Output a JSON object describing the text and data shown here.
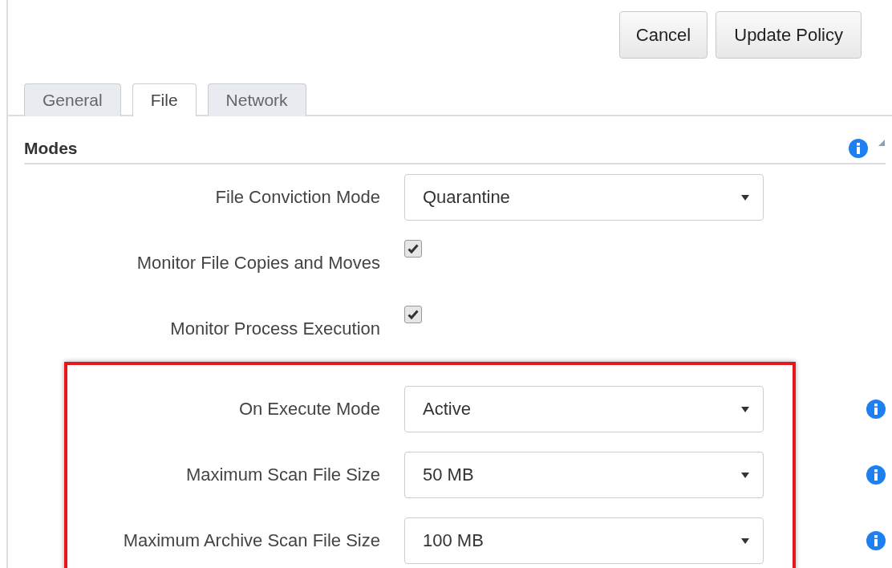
{
  "buttons": [
    {
      "label": "Cancel",
      "kind": "secondary"
    },
    {
      "label": "Update Policy",
      "kind": "primary"
    }
  ],
  "tabs": [
    {
      "label": "General",
      "selected": false
    },
    {
      "label": "File",
      "selected": true
    },
    {
      "label": "Network",
      "selected": false
    }
  ],
  "section": {
    "title": "Modes",
    "info": true,
    "expanded": true
  },
  "fields": [
    {
      "label": "File Conviction Mode",
      "kind": "select",
      "value": "Quarantine",
      "info": false
    },
    {
      "label": "Monitor File Copies and Moves",
      "kind": "checkbox",
      "checked": true,
      "info": false
    },
    {
      "label": "Monitor Process Execution",
      "kind": "checkbox",
      "checked": true,
      "info": false
    }
  ],
  "highlighted_fields": [
    {
      "label": "On Execute Mode",
      "kind": "select",
      "value": "Active",
      "info": true
    },
    {
      "label": "Maximum Scan File Size",
      "kind": "select",
      "value": "50 MB",
      "info": true
    },
    {
      "label": "Maximum Archive Scan File Size",
      "kind": "select",
      "value": "100 MB",
      "info": true
    }
  ]
}
